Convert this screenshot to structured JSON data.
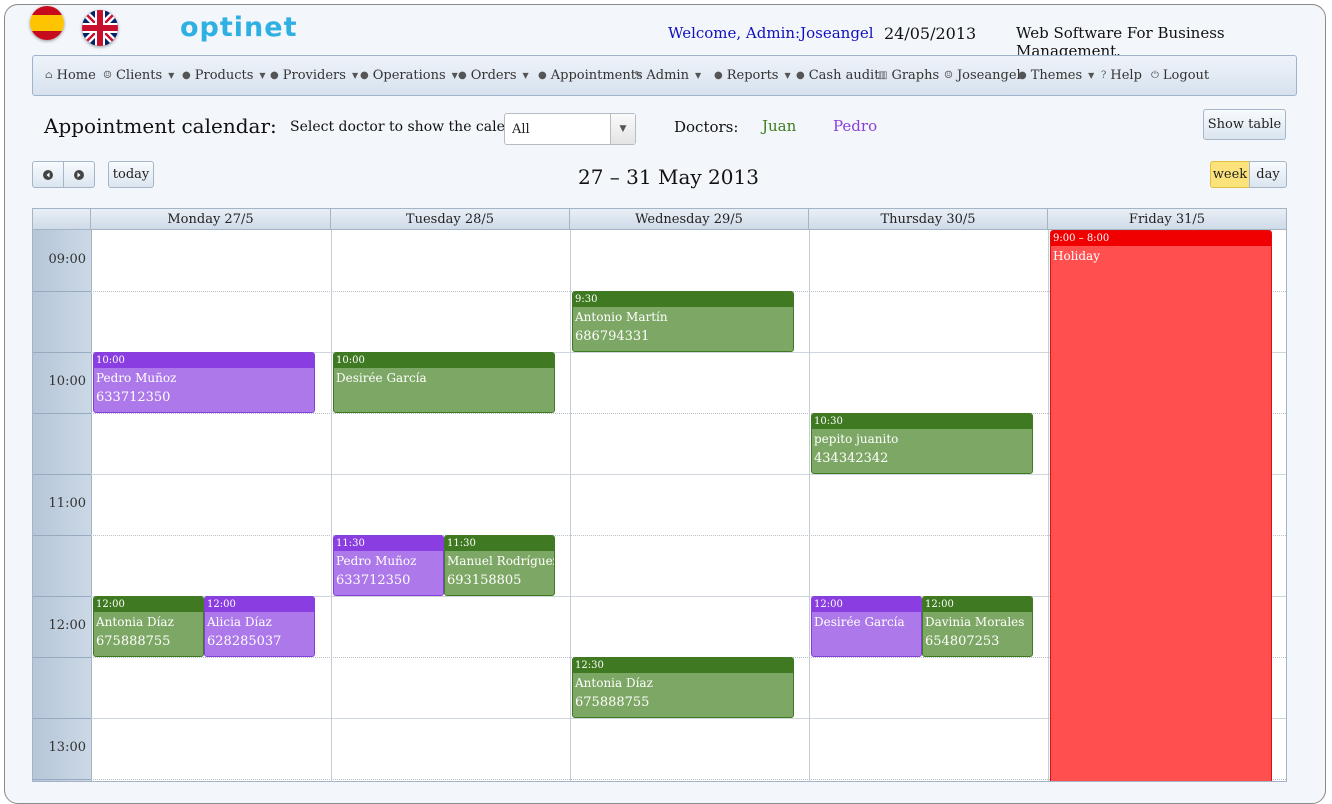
{
  "header": {
    "logo": "optinet",
    "welcome": "Welcome, Admin:Joseangel",
    "date": "24/05/2013",
    "tagline": "Web Software For Business Management."
  },
  "nav": [
    {
      "label": "Home",
      "icon": "home-icon",
      "dropdown": false
    },
    {
      "label": "Clients",
      "icon": "user-icon",
      "dropdown": true
    },
    {
      "label": "Products",
      "icon": "bullet-icon",
      "dropdown": true
    },
    {
      "label": "Providers",
      "icon": "bullet-icon",
      "dropdown": true
    },
    {
      "label": "Operations",
      "icon": "bullet-icon",
      "dropdown": true
    },
    {
      "label": "Orders",
      "icon": "bullet-icon",
      "dropdown": true
    },
    {
      "label": "Appointments",
      "icon": "bullet-icon",
      "dropdown": false
    },
    {
      "label": "Admin",
      "icon": "wrench-icon",
      "dropdown": true
    },
    {
      "label": "Reports",
      "icon": "bullet-icon",
      "dropdown": true
    },
    {
      "label": "Cash audit",
      "icon": "bullet-icon",
      "dropdown": false
    },
    {
      "label": "Graphs",
      "icon": "chart-icon",
      "dropdown": false
    },
    {
      "label": "Joseangel",
      "icon": "user-icon",
      "dropdown": false
    },
    {
      "label": "Themes",
      "icon": "bullet-icon",
      "dropdown": true
    },
    {
      "label": "Help",
      "icon": "question-icon",
      "dropdown": false
    },
    {
      "label": "Logout",
      "icon": "power-icon",
      "dropdown": false
    }
  ],
  "toolbar": {
    "title": "Appointment calendar:",
    "select_label": "Select doctor to show the calendar:",
    "select_value": "All",
    "doctors_label": "Doctors:",
    "doctors": [
      {
        "name": "Juan",
        "color": "#3d7f1e"
      },
      {
        "name": "Pedro",
        "color": "#8a3fd8"
      }
    ],
    "show_table": "Show table"
  },
  "calendar": {
    "today": "today",
    "range_title": "27 – 31 May 2013",
    "views": {
      "week": "week",
      "day": "day",
      "active": "week"
    },
    "days": [
      "Monday 27/5",
      "Tuesday 28/5",
      "Wednesday 29/5",
      "Thursday 30/5",
      "Friday 31/5"
    ],
    "hours": [
      "09:00",
      "10:00",
      "11:00",
      "12:00",
      "13:00"
    ],
    "events": [
      {
        "day": 4,
        "start": "9:00",
        "time": "9:00 – 8:00",
        "name": "Holiday",
        "phone": "",
        "type": "h"
      },
      {
        "day": 2,
        "start": "9:30",
        "time": "9:30",
        "name": "Antonio Martín",
        "phone": "686794331",
        "type": "g"
      },
      {
        "day": 0,
        "start": "10:00",
        "time": "10:00",
        "name": "Pedro Muñoz",
        "phone": "633712350",
        "type": "p"
      },
      {
        "day": 1,
        "start": "10:00",
        "time": "10:00",
        "name": "Desirée García",
        "phone": "",
        "type": "g"
      },
      {
        "day": 3,
        "start": "10:30",
        "time": "10:30",
        "name": "pepito juanito",
        "phone": "434342342",
        "type": "g"
      },
      {
        "day": 1,
        "start": "11:30",
        "time": "11:30",
        "name": "Pedro Muñoz",
        "phone": "633712350",
        "type": "p",
        "half": 0
      },
      {
        "day": 1,
        "start": "11:30",
        "time": "11:30",
        "name": "Manuel Rodríguez",
        "phone": "693158805",
        "type": "g",
        "half": 1
      },
      {
        "day": 0,
        "start": "12:00",
        "time": "12:00",
        "name": "Antonia Díaz",
        "phone": "675888755",
        "type": "g",
        "half": 0
      },
      {
        "day": 0,
        "start": "12:00",
        "time": "12:00",
        "name": "Alicia Díaz",
        "phone": "628285037",
        "type": "p",
        "half": 1
      },
      {
        "day": 3,
        "start": "12:00",
        "time": "12:00",
        "name": "Desirée García",
        "phone": "",
        "type": "p",
        "half": 0
      },
      {
        "day": 3,
        "start": "12:00",
        "time": "12:00",
        "name": "Davinia Morales",
        "phone": "654807253",
        "type": "g",
        "half": 1
      },
      {
        "day": 2,
        "start": "12:30",
        "time": "12:30",
        "name": "Antonia Díaz",
        "phone": "675888755",
        "type": "g"
      }
    ]
  }
}
